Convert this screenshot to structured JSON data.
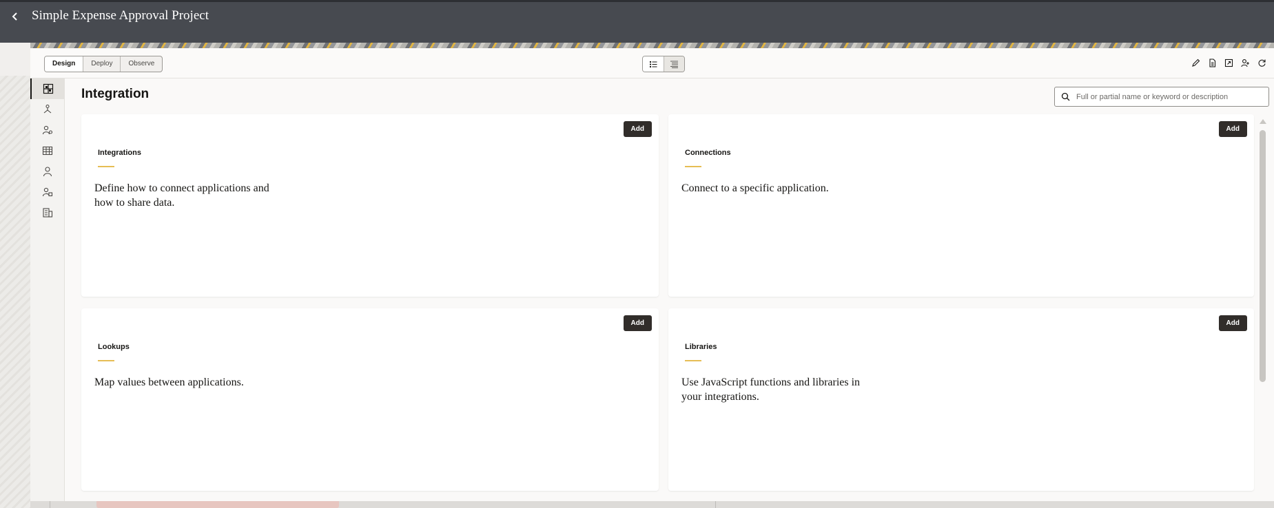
{
  "header": {
    "title": "Simple Expense Approval Project"
  },
  "modes": [
    {
      "label": "Design",
      "active": true
    },
    {
      "label": "Deploy",
      "active": false
    },
    {
      "label": "Observe",
      "active": false
    }
  ],
  "toolbar_icons": [
    "edit-icon",
    "document-icon",
    "export-icon",
    "user-access-icon",
    "refresh-icon"
  ],
  "rail_icons": [
    "integrations-icon",
    "flow-icon",
    "connections-icon",
    "lookups-table-icon",
    "person-icon",
    "libraries-icon",
    "building-icon"
  ],
  "page": {
    "title": "Integration"
  },
  "search": {
    "placeholder": "Full or partial name or keyword or description"
  },
  "cards": [
    {
      "title": "Integrations",
      "description": "Define how to connect applications and how to share data.",
      "add_label": "Add"
    },
    {
      "title": "Connections",
      "description": "Connect to a specific application.",
      "add_label": "Add"
    },
    {
      "title": "Lookups",
      "description": "Map values between applications.",
      "add_label": "Add"
    },
    {
      "title": "Libraries",
      "description": "Use JavaScript functions and libraries in your integrations.",
      "add_label": "Add"
    }
  ],
  "colors": {
    "header_bg": "#474a50",
    "accent": "#e6bd54",
    "button_dark": "#312d2a"
  }
}
